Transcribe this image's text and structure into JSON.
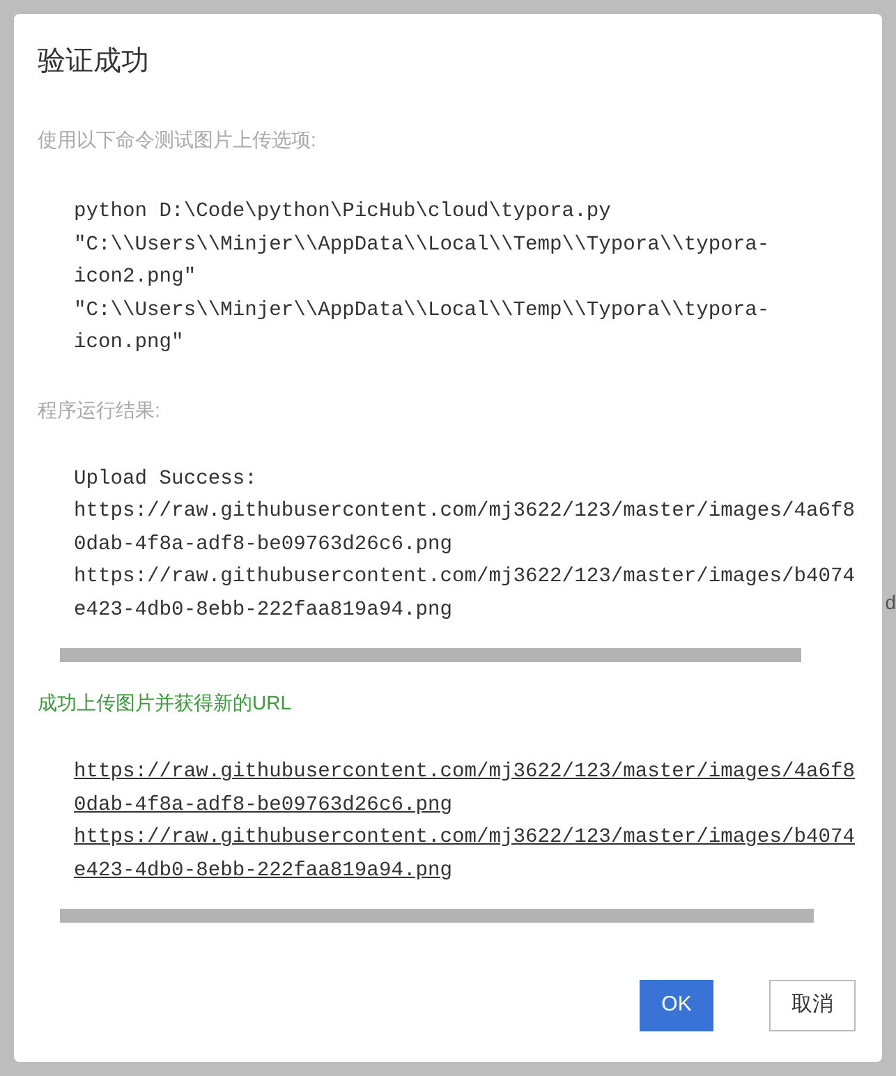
{
  "background": {
    "edge_text": "d"
  },
  "dialog": {
    "title": "验证成功",
    "command_label": "使用以下命令测试图片上传选项:",
    "command_lines": [
      "python D:\\Code\\python\\PicHub\\cloud\\typora.py",
      "\"C:\\\\Users\\\\Minjer\\\\AppData\\\\Local\\\\Temp\\\\Typora\\\\typora-icon2.png\"",
      "\"C:\\\\Users\\\\Minjer\\\\AppData\\\\Local\\\\Temp\\\\Typora\\\\typora-icon.png\""
    ],
    "result_label": "程序运行结果:",
    "output_lines": [
      "Upload Success:",
      "https://raw.githubusercontent.com/mj3622/123/master/images/4a6f80dab-4f8a-adf8-be09763d26c6.png",
      "https://raw.githubusercontent.com/mj3622/123/master/images/b4074e423-4db0-8ebb-222faa819a94.png"
    ],
    "success_message": "成功上传图片并获得新的URL",
    "urls": [
      "https://raw.githubusercontent.com/mj3622/123/master/images/4a6f80dab-4f8a-adf8-be09763d26c6.png",
      "https://raw.githubusercontent.com/mj3622/123/master/images/b4074e423-4db0-8ebb-222faa819a94.png"
    ],
    "buttons": [
      {
        "label": "OK",
        "kind": "primary"
      },
      {
        "label": "取消",
        "kind": "secondary"
      }
    ]
  }
}
